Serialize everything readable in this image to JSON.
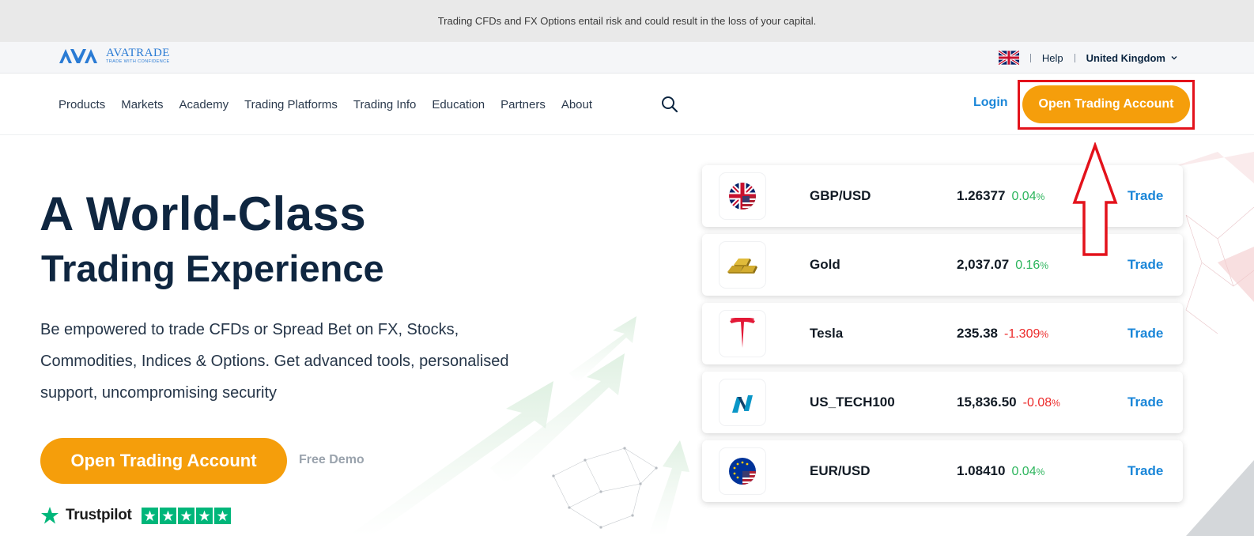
{
  "risk_banner": {
    "text": "Trading CFDs and FX Options entail risk and could result in the loss of your capital."
  },
  "logo": {
    "name": "AVATRADE",
    "tagline": "TRADE WITH CONFIDENCE"
  },
  "util": {
    "help": "Help",
    "country": "United Kingdom"
  },
  "nav": {
    "items": [
      "Products",
      "Markets",
      "Academy",
      "Trading Platforms",
      "Trading Info",
      "Education",
      "Partners",
      "About"
    ],
    "login": "Login",
    "open_account": "Open Trading Account"
  },
  "hero": {
    "title_line1": "A World-Class",
    "title_line2": "Trading Experience",
    "description": "Be empowered to trade CFDs or Spread Bet on FX, Stocks, Commodities, Indices & Options. Get advanced tools, personalised support, uncompromising security",
    "cta": "Open Trading Account",
    "free_demo": "Free Demo",
    "trustpilot": "Trustpilot"
  },
  "quotes": [
    {
      "icon": "gbp-usd-flag-icon",
      "name": "GBP/USD",
      "price": "1.26377",
      "change": "0.04",
      "pct": "%",
      "direction": "up",
      "trade": "Trade"
    },
    {
      "icon": "gold-bars-icon",
      "name": "Gold",
      "price": "2,037.07",
      "change": "0.16",
      "pct": "%",
      "direction": "up",
      "trade": "Trade"
    },
    {
      "icon": "tesla-logo-icon",
      "name": "Tesla",
      "price": "235.38",
      "change": "-1.309",
      "pct": "%",
      "direction": "down",
      "trade": "Trade"
    },
    {
      "icon": "nasdaq-logo-icon",
      "name": "US_TECH100",
      "price": "15,836.50",
      "change": "-0.08",
      "pct": "%",
      "direction": "down",
      "trade": "Trade"
    },
    {
      "icon": "eur-usd-flag-icon",
      "name": "EUR/USD",
      "price": "1.08410",
      "change": "0.04",
      "pct": "%",
      "direction": "up",
      "trade": "Trade"
    }
  ],
  "colors": {
    "accent": "#f59e0b",
    "link": "#1a86d8",
    "positive": "#2db55d",
    "negative": "#ec2a2a",
    "highlight": "#e3121b"
  }
}
